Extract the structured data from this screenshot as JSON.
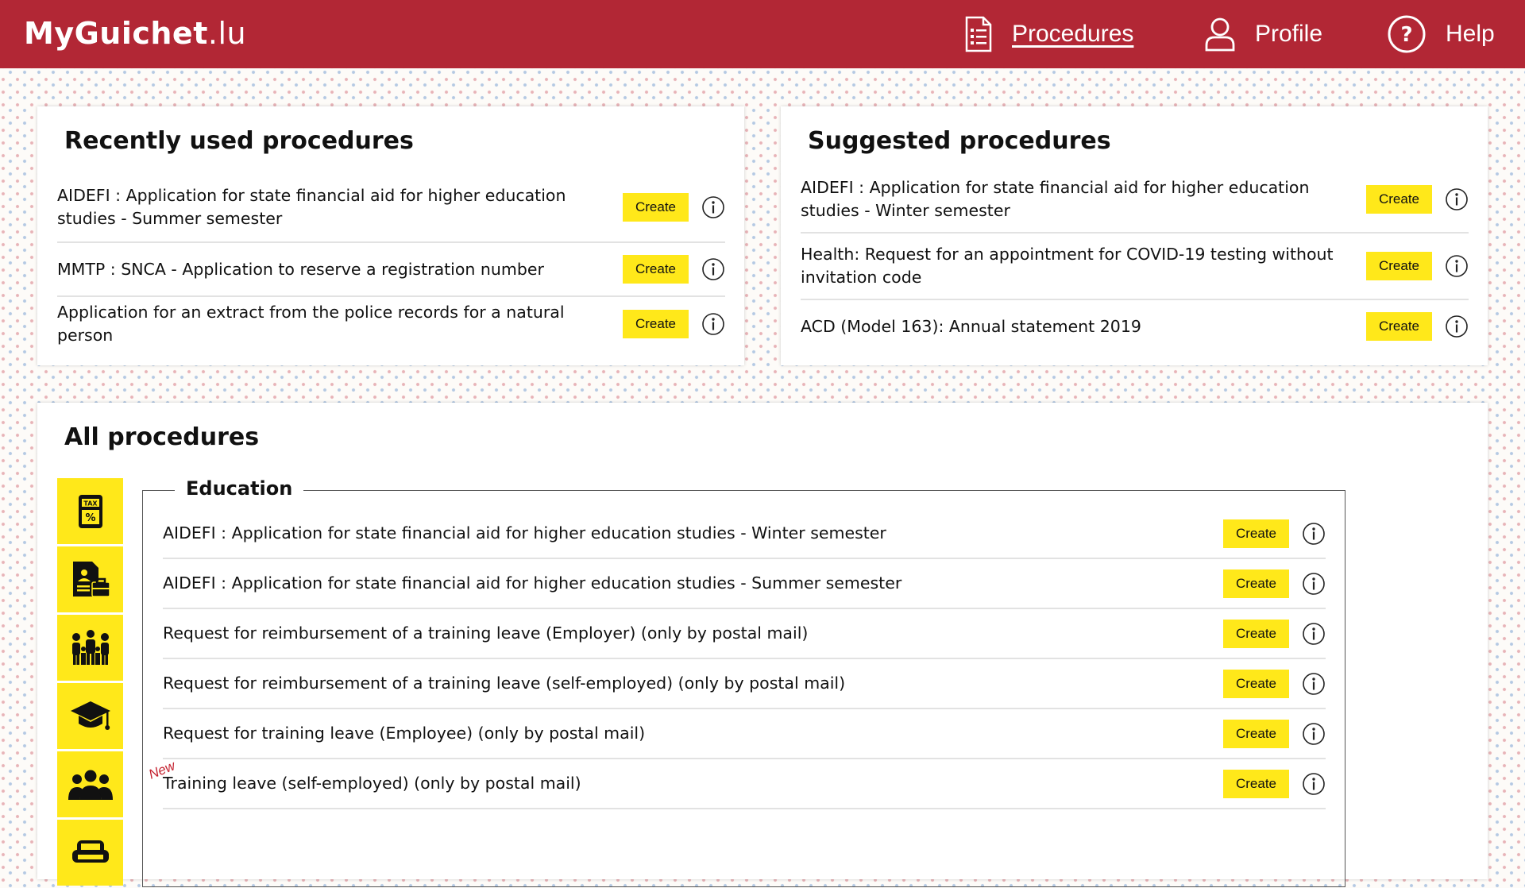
{
  "header": {
    "logo_main": "MyGuichet",
    "logo_tld": ".lu",
    "nav": {
      "procedures": "Procedures",
      "profile": "Profile",
      "help": "Help"
    }
  },
  "recent": {
    "title": "Recently used procedures",
    "items": [
      {
        "label": "AIDEFI : Application for state financial aid for higher education studies - Summer semester",
        "button": "Create"
      },
      {
        "label": "MMTP : SNCA - Application to reserve a registration number",
        "button": "Create"
      },
      {
        "label": "Application for an extract from the police records for a natural person",
        "button": "Create"
      }
    ]
  },
  "suggested": {
    "title": "Suggested procedures",
    "items": [
      {
        "label": "AIDEFI : Application for state financial aid for higher education studies - Winter semester",
        "button": "Create"
      },
      {
        "label": "Health: Request for an appointment for COVID-19 testing without invitation code",
        "button": "Create"
      },
      {
        "label": "ACD (Model 163): Annual statement 2019",
        "button": "Create"
      }
    ]
  },
  "all": {
    "title": "All procedures",
    "categories": [
      {
        "icon": "tax-calculator-icon"
      },
      {
        "icon": "employment-document-icon"
      },
      {
        "icon": "family-icon"
      },
      {
        "icon": "graduation-cap-icon"
      },
      {
        "icon": "group-people-icon"
      },
      {
        "icon": "sofa-icon"
      }
    ],
    "education": {
      "title": "Education",
      "new_badge": "New",
      "items": [
        {
          "label": "AIDEFI : Application for state financial aid for higher education studies - Winter semester",
          "button": "Create"
        },
        {
          "label": "AIDEFI : Application for state financial aid for higher education studies - Summer semester",
          "button": "Create"
        },
        {
          "label": "Request for reimbursement of a training leave (Employer) (only by postal mail)",
          "button": "Create"
        },
        {
          "label": "Request for reimbursement of a training leave (self-employed) (only by postal mail)",
          "button": "Create"
        },
        {
          "label": "Request for training leave (Employee) (only by postal mail)",
          "button": "Create"
        },
        {
          "label": "Training leave (self-employed) (only by postal mail)",
          "button": "Create"
        }
      ]
    }
  },
  "colors": {
    "header_bg": "#b22735",
    "button_yellow": "#ffe81a",
    "new_red": "#c4212f"
  }
}
